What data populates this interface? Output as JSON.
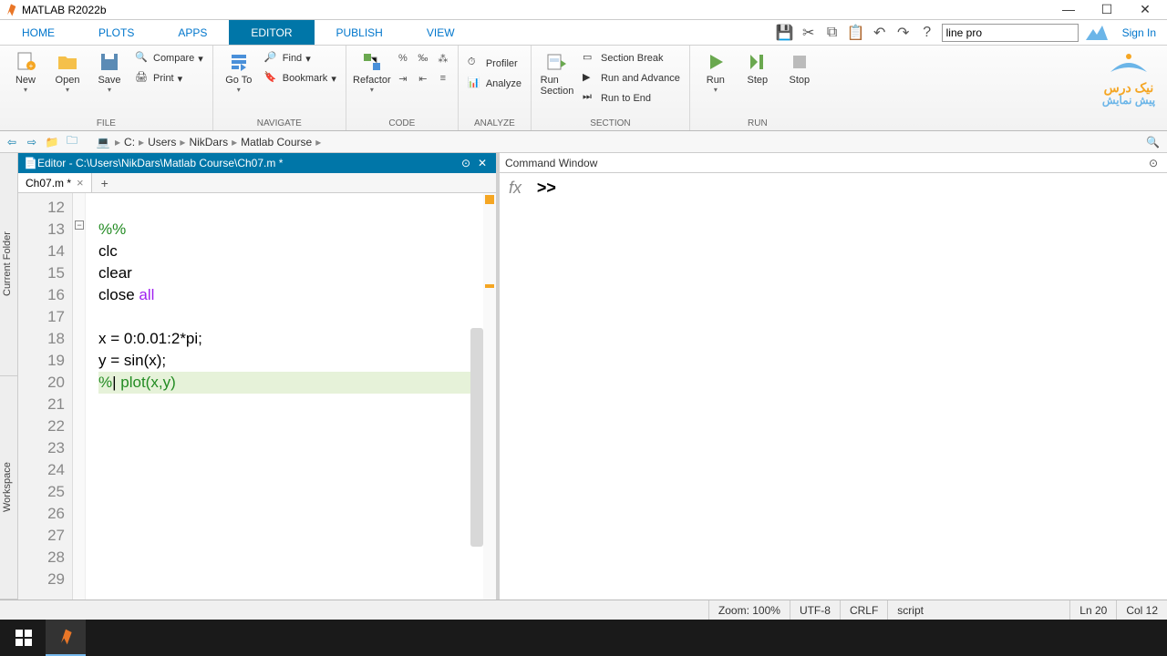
{
  "window": {
    "title": "MATLAB R2022b"
  },
  "menutabs": {
    "home": "HOME",
    "plots": "PLOTS",
    "apps": "APPS",
    "editor": "EDITOR",
    "publish": "PUBLISH",
    "view": "VIEW"
  },
  "search": {
    "value": "line pro"
  },
  "signin": "Sign In",
  "ribbon": {
    "new": "New",
    "open": "Open",
    "save": "Save",
    "compare": "Compare",
    "print": "Print",
    "goto": "Go To",
    "find": "Find",
    "bookmark": "Bookmark",
    "refactor": "Refactor",
    "profiler": "Profiler",
    "analyze": "Analyze",
    "sectionbreak": "Section Break",
    "runadvance": "Run and Advance",
    "runtoend": "Run to End",
    "runsection": "Run\nSection",
    "run": "Run",
    "step": "Step",
    "stop": "Stop",
    "groups": {
      "file": "FILE",
      "navigate": "NAVIGATE",
      "code": "CODE",
      "analyze": "ANALYZE",
      "section": "SECTION",
      "run": "RUN"
    }
  },
  "brand": {
    "line1": "نیک درس",
    "line2": "پیش نمایش"
  },
  "path": {
    "c": "C:",
    "users": "Users",
    "nikdars": "NikDars",
    "course": "Matlab Course"
  },
  "sidetabs": {
    "folder": "Current Folder",
    "workspace": "Workspace"
  },
  "editor": {
    "title": "Editor - C:\\Users\\NikDars\\Matlab Course\\Ch07.m *",
    "tab": "Ch07.m *",
    "lines": {
      "start": 12,
      "rows": [
        "12",
        "13",
        "14",
        "15",
        "16",
        "17",
        "18",
        "19",
        "20",
        "21",
        "22",
        "23",
        "24",
        "25",
        "26",
        "27",
        "28",
        "29"
      ]
    },
    "code": {
      "l12": "",
      "l13_pre": "%%",
      "l14": "clc",
      "l15": "clear",
      "l16a": "close ",
      "l16b": "all",
      "l17": "",
      "l18": "x = 0:0.01:2*pi;",
      "l19": "y = sin(x);",
      "l20a": "%",
      "l20cursor": "|",
      "l20b": " plot(x,y)"
    }
  },
  "cmd": {
    "title": "Command Window",
    "fx": "fx",
    "prompt": ">>"
  },
  "status": {
    "zoom": "Zoom: 100%",
    "enc": "UTF-8",
    "eol": "CRLF",
    "type": "script",
    "ln": "Ln  20",
    "col": "Col  12"
  }
}
